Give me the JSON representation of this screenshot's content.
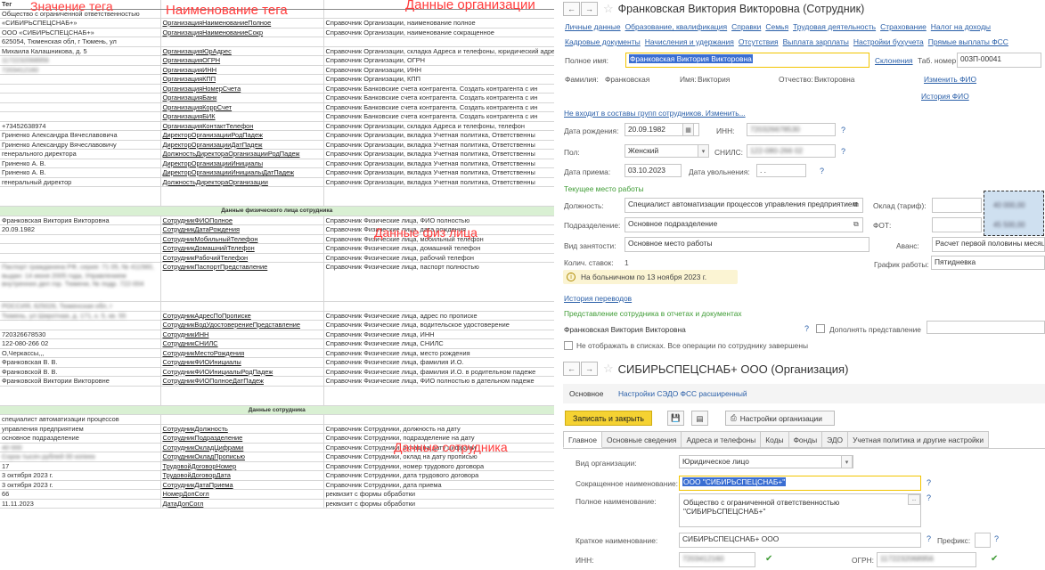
{
  "overlays": {
    "tag_value": "Значение тега",
    "tag_name": "Наименование тега",
    "org_data": "Данные организации",
    "person_data": "Данные физ лица",
    "employee_data": "Данные сотрудника"
  },
  "sheet": {
    "header": {
      "c1": "Тег",
      "c2": "",
      "c3": ""
    },
    "org_rows": [
      {
        "c1": "Общество с ограниченной ответственностью",
        "c2": "",
        "c3": ""
      },
      {
        "c1": "«СИБИРЬСПЕЦСНАБ+»",
        "c2": "ОрганизацияНаименованиеПолное",
        "c3": "Справочник Организации, наименование полное"
      },
      {
        "c1": "ООО «СИБИРЬСПЕЦСНАБ+»",
        "c2": "ОрганизацияНаименованиеСокр",
        "c3": "Справочник Организации, наименование сокращенное"
      },
      {
        "c1": "625054, Тюменская обл, г Тюмень, ул",
        "c2": "",
        "c3": ""
      },
      {
        "c1": "Михаила Калашникова, д. 5",
        "c2": "ОрганизацияЮрАдрес",
        "c3": "Справочник Организации, складка Адреса и телефоны, юридический адрес"
      },
      {
        "c1": "1172232068956",
        "c2": "ОрганизацияОГРН",
        "c3": "Справочник Организации, ОГРН",
        "blur": true
      },
      {
        "c1": "7203412160",
        "c2": "ОрганизацияИНН",
        "c3": "Справочник Организации, ИНН",
        "blur": true
      },
      {
        "c1": "",
        "c2": "ОрганизацияКПП",
        "c3": "Справочник Организации, КПП"
      },
      {
        "c1": "",
        "c2": "ОрганизацияНомерСчета",
        "c3": "Справочник Банковские счета контрагента. Создать контрагента с ин"
      },
      {
        "c1": "",
        "c2": "ОрганизацияБанк",
        "c3": "Справочник Банковские счета контрагента. Создать контрагента с ин"
      },
      {
        "c1": "",
        "c2": "ОрганизацияКоррСчет",
        "c3": "Справочник Банковские счета контрагента. Создать контрагента с ин"
      },
      {
        "c1": "",
        "c2": "ОрганизацияБИК",
        "c3": "Справочник Банковские счета контрагента. Создать контрагента с ин"
      },
      {
        "c1": "+73452638974",
        "c2": "ОрганизацияКонтактТелефон",
        "c3": "Справочник Организации, складка Адреса и телефоны, телефон"
      },
      {
        "c1": "Гриненко Александра Вячеславовича",
        "c2": "ДиректорОрганизацииРодПадеж",
        "c3": "Справочник Организации, вкладка Учетная политика, Ответственны"
      },
      {
        "c1": "Гриненко Александру Вячеславовичу",
        "c2": "ДиректорОрганизацииДатПадеж",
        "c3": "Справочник Организации, вкладка Учетная политика, Ответственны"
      },
      {
        "c1": "генерального директора",
        "c2": "ДолжностьДиректораОрганизацииРодПадеж",
        "c3": "Справочник Организации, вкладка Учетная политика, Ответственны"
      },
      {
        "c1": "Гриненко А. В.",
        "c2": "ДиректорОрганизацииИнициалы",
        "c3": "Справочник Организации, вкладка Учетная политика, Ответственны"
      },
      {
        "c1": "Гриненко А. В.",
        "c2": "ДиректорОрганизацииИнициалыДатПадеж",
        "c3": "Справочник Организации, вкладка Учетная политика, Ответственны"
      },
      {
        "c1": "генеральный директор",
        "c2": "ДолжностьДиректораОрганизации",
        "c3": "Справочник Организации, вкладка Учетная политика, Ответственны"
      }
    ],
    "person_section": "Данные физического лица сотрудника",
    "person_rows": [
      {
        "c1": "Франковская Виктория Викторовна",
        "c2": "СотрудникФИОПолное",
        "c3": "Справочник Физические лица, ФИО полностью"
      },
      {
        "c1": "20.09.1982",
        "c2": "СотрудникДатаРождения",
        "c3": "Справочник Физические лица, дата рождения"
      },
      {
        "c1": "",
        "c2": "СотрудникМобильныйТелефон",
        "c3": "Справочник Физические лица, мобильный телефон"
      },
      {
        "c1": "",
        "c2": "СотрудникДомашнийТелефон",
        "c3": "Справочник Физические лица, домашний телефон"
      },
      {
        "c1": "",
        "c2": "СотрудникРабочийТелефон",
        "c3": "Справочник Физические лица, рабочий телефон"
      }
    ],
    "passport_row": {
      "c1": "Паспорт гражданина РФ, серия: 71 05, № 411560, выдан: 14 июня 2005 года, Управлением внутренних дел гор. Тюмени, № подр. 722-004",
      "c2": "СотрудникПаспортПредставление",
      "c3": "Справочник Физические лица, паспорт полностью"
    },
    "person_rows2": [
      {
        "c1": "РОССИЯ, 625026, Тюменская обл, г",
        "c2": "",
        "c3": "",
        "blur": true
      },
      {
        "c1": "Тюмень, ул Широтная, д. 171, к. 5, кв. 55",
        "c2": "СотрудникАдресПоПрописке",
        "c3": "Справочник Физические лица, адрес по прописке",
        "blur": true
      },
      {
        "c1": "",
        "c2": "СотрудникВодУдостоверениеПредставление",
        "c3": "Справочник Физические лица, водительское удостоверение"
      },
      {
        "c1": "720326678530",
        "c2": "СотрудникИНН",
        "c3": "Справочник Физические лица, ИНН"
      },
      {
        "c1": "122-080-266 02",
        "c2": "СотрудникСНИЛС",
        "c3": "Справочник Физические лица, СНИЛС"
      },
      {
        "c1": "О,Черкассы,,,",
        "c2": "СотрудникМестоРождения",
        "c3": "Справочник Физические лица, место рождения"
      },
      {
        "c1": "Франковская В. В.",
        "c2": "СотрудникФИОИнициалы",
        "c3": "Справочник Физические лица, фамилия И.О."
      },
      {
        "c1": "Франковской В. В.",
        "c2": "СотрудникФИОИнициалыРодПадеж",
        "c3": "Справочник Физические лица, фамилия И.О. в родительном падеже"
      },
      {
        "c1": "Франковской Виктории Викторовне",
        "c2": "СотрудникФИОПолноеДатПадеж",
        "c3": "Справочник Физические лица, ФИО полностью в дательном падеже"
      }
    ],
    "employee_section": "Данные сотрудника",
    "employee_rows": [
      {
        "c1": "специалист автоматизации процессов",
        "c2": "",
        "c3": ""
      },
      {
        "c1": "управления предприятием",
        "c2": "СотрудникДолжность",
        "c3": "Справочник Сотрудники, должность на дату"
      },
      {
        "c1": "основное подразделение",
        "c2": "СотрудникПодразделение",
        "c3": "Справочник Сотрудники, подразделение на дату"
      },
      {
        "c1": "40 000",
        "c2": "СотрудникОкладЦифрами",
        "c3": "Справочник Сотрудники, оклад на дату цифрами",
        "blur": true
      },
      {
        "c1": "Сорок тысяч рублей 00 копеек",
        "c2": "СотрудникОкладПрописью",
        "c3": "Справочник Сотрудники, оклад на дату прописью",
        "blur": true
      },
      {
        "c1": "17",
        "c2": "ТрудовойДоговорНомер",
        "c3": "Справочник Сотрудники, номер трудового договора"
      },
      {
        "c1": "3 октября 2023 г.",
        "c2": "ТрудовойДоговорДата",
        "c3": "Справочник Сотрудники, дата трудового договора"
      },
      {
        "c1": "3 октября 2023 г.",
        "c2": "СотрудникДатаПриема",
        "c3": "Справочник Сотрудники, дата приема"
      },
      {
        "c1": "66",
        "c2": "НомерДопСогл",
        "c3": "реквизит с формы обработки"
      },
      {
        "c1": "11.11.2023",
        "c2": "ДатаДопСогл",
        "c3": "реквизит с формы обработки"
      }
    ]
  },
  "employee_form": {
    "title": "Франковская Виктория Викторовна (Сотрудник)",
    "links_row1": [
      "Личные данные",
      "Образование, квалификация",
      "Справки",
      "Семья",
      "Трудовая деятельность",
      "Страхование",
      "Налог на доходы"
    ],
    "links_row2": [
      "Кадровые документы",
      "Начисления и удержания",
      "Отсутствия",
      "Выплата зарплаты",
      "Настройки бухучета",
      "Прямые выплаты ФСС"
    ],
    "full_name_label": "Полное имя:",
    "full_name": "Франковская Виктория Викторовна",
    "declensions": "Склонения",
    "tab_no_label": "Таб. номер:",
    "tab_no": "003П-00041",
    "surname_label": "Фамилия:",
    "surname": "Франковская",
    "name_label": "Имя:",
    "name": "Виктория",
    "patronymic_label": "Отчество:",
    "patronymic": "Викторовна",
    "change_fio": "Изменить ФИО",
    "history_fio": "История ФИО",
    "groups_link": "Не входит в составы групп сотрудников. Изменить...",
    "dob_label": "Дата рождения:",
    "dob": "20.09.1982",
    "inn_label": "ИНН:",
    "inn": "720326678530",
    "sex_label": "Пол:",
    "sex": "Женский",
    "snils_label": "СНИЛС:",
    "snils": "122-080-266 02",
    "hire_label": "Дата приема:",
    "hire": "03.10.2023",
    "fire_label": "Дата увольнения:",
    "fire_placeholder": " .  .",
    "current_place": "Текущее место работы",
    "position_label": "Должность:",
    "position": "Специалист автоматизации процессов управления предприятием",
    "salary_label": "Оклад (тариф):",
    "salary": "40 000,00",
    "division_label": "Подразделение:",
    "division": "Основное подразделение",
    "fot_label": "ФОТ:",
    "fot": "45 500,00",
    "employment_label": "Вид занятости:",
    "employment": "Основное место работы",
    "advance_label": "Аванс:",
    "advance": "Расчет первой половины месяца",
    "rates_label": "Колич. ставок:",
    "rates": "1",
    "schedule_label": "График работы:",
    "schedule": "Пятидневка",
    "sick_info": "На больничном по 13 ноября 2023 г.",
    "history_transfers": "История переводов",
    "presentation_header": "Представление сотрудника в отчетах и документах",
    "presentation": "Франковская Виктория Викторовна",
    "supplement_label": "Дополнять представление",
    "hide_label": "Не отображать в списках. Все операции по сотруднику завершены"
  },
  "org_form": {
    "title": "СИБИРЬСПЕЦСНАБ+ ООО (Организация)",
    "nav_main": "Основное",
    "nav_sedo": "Настройки СЭДО ФСС расширенный",
    "save_close": "Записать и закрыть",
    "settings_btn": "Настройки организации",
    "tabs": [
      "Главное",
      "Основные сведения",
      "Адреса и телефоны",
      "Коды",
      "Фонды",
      "ЭДО",
      "Учетная политика и другие настройки"
    ],
    "kind_label": "Вид организации:",
    "kind": "Юридическое лицо",
    "short_label": "Сокращенное наименование:",
    "short_name": "ООО \"СИБИРЬСПЕЦСНАБ+\"",
    "full_label": "Полное наименование:",
    "full_name_1": "Общество с ограниченной ответственностью",
    "full_name_2": "\"СИБИРЬСПЕЦСНАБ+\"",
    "brief_label": "Краткое наименование:",
    "brief": "СИБИРЬСПЕЦСНАБ+ ООО",
    "prefix_label": "Префикс:",
    "inn_label": "ИНН:",
    "inn": "7203412160",
    "ogrn_label": "ОГРН:",
    "ogrn": "1172232068956"
  }
}
